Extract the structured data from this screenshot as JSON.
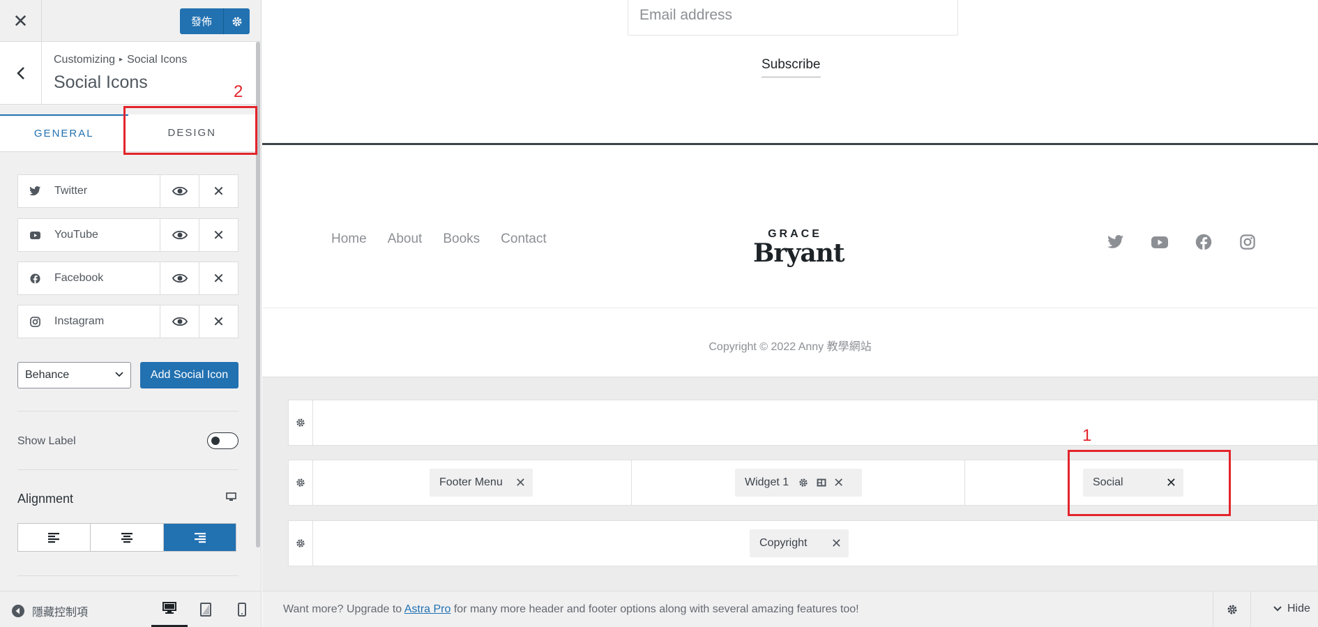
{
  "sidebar": {
    "close_icon": "close-icon",
    "publish_label": "發佈",
    "breadcrumb_parent": "Customizing",
    "breadcrumb_sep": "▸",
    "breadcrumb_current": "Social Icons",
    "section_title": "Social Icons",
    "tabs": [
      {
        "label": "GENERAL",
        "active": true
      },
      {
        "label": "DESIGN",
        "active": false
      }
    ],
    "social_items": [
      {
        "label": "Twitter",
        "icon": "twitter-icon"
      },
      {
        "label": "YouTube",
        "icon": "youtube-icon"
      },
      {
        "label": "Facebook",
        "icon": "facebook-icon"
      },
      {
        "label": "Instagram",
        "icon": "instagram-icon"
      }
    ],
    "select_value": "Behance",
    "add_button": "Add Social Icon",
    "show_label": "Show Label",
    "show_label_on": false,
    "alignment_title": "Alignment",
    "alignment_selected": "right",
    "footer": {
      "collapse_label": "隱藏控制項",
      "devices": [
        "desktop",
        "tablet",
        "mobile"
      ],
      "active_device": "desktop"
    }
  },
  "preview": {
    "email_placeholder": "Email address",
    "subscribe_label": "Subscribe",
    "nav": [
      "Home",
      "About",
      "Books",
      "Contact"
    ],
    "logo_line1": "GRACE",
    "logo_line2": "Bryant",
    "footer_social": [
      "twitter-icon",
      "youtube-icon",
      "facebook-icon",
      "instagram-icon"
    ],
    "copyright": "Copyright © 2022 Anny 教學網站"
  },
  "builder": {
    "rows": [
      {
        "chips": []
      },
      {
        "chips": [
          {
            "label": "Footer Menu"
          },
          {
            "label": "Widget 1"
          },
          {
            "label": "Social"
          }
        ]
      },
      {
        "chips": [
          {
            "label": "Copyright"
          }
        ]
      }
    ]
  },
  "upgrade": {
    "prefix": "Want more? Upgrade to ",
    "link": "Astra Pro",
    "suffix": " for many more header and footer options along with several amazing features too!",
    "hide_label": "Hide"
  },
  "annotations": {
    "one": "1",
    "two": "2"
  },
  "colors": {
    "accent": "#2271b1",
    "annotation": "#e3242b"
  }
}
